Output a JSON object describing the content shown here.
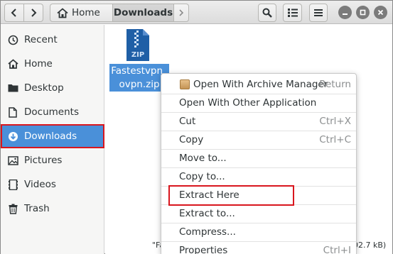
{
  "header": {
    "path": {
      "home_label": "Home",
      "current_label": "Downloads"
    }
  },
  "sidebar": {
    "items": [
      {
        "label": "Recent",
        "icon": "clock-icon"
      },
      {
        "label": "Home",
        "icon": "home-icon"
      },
      {
        "label": "Desktop",
        "icon": "folder-icon"
      },
      {
        "label": "Documents",
        "icon": "document-icon"
      },
      {
        "label": "Downloads",
        "icon": "download-icon",
        "selected": true
      },
      {
        "label": "Pictures",
        "icon": "image-icon"
      },
      {
        "label": "Videos",
        "icon": "film-icon"
      },
      {
        "label": "Trash",
        "icon": "trash-icon"
      }
    ]
  },
  "main": {
    "file": {
      "name_line1": "Fastestvpn_",
      "name_line2": "ovpn.zip",
      "icon_text": "ZIP",
      "selected": true
    },
    "status_text": "\"Fa",
    "status_size": "02.7 kB)"
  },
  "context_menu": {
    "items": [
      {
        "label": "Open With Archive Manager",
        "accel": "Return"
      },
      {
        "label": "Open With Other Application",
        "accel": ""
      },
      {
        "label": "Cut",
        "accel": "Ctrl+X"
      },
      {
        "label": "Copy",
        "accel": "Ctrl+C"
      },
      {
        "label": "Move to...",
        "accel": ""
      },
      {
        "label": "Copy to...",
        "accel": ""
      },
      {
        "label": "Extract Here",
        "accel": ""
      },
      {
        "label": "Extract to...",
        "accel": ""
      },
      {
        "label": "Compress...",
        "accel": ""
      },
      {
        "label": "Properties",
        "accel": "Ctrl+I"
      }
    ],
    "highlighted": "Extract Here"
  },
  "colors": {
    "selection": "#4a90d9",
    "annotation_red": "#d9161e",
    "zip_icon": "#1f5fa6"
  }
}
